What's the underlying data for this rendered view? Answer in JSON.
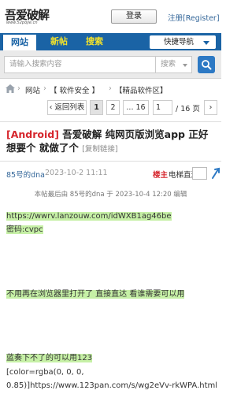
{
  "header": {
    "logo_text": "吾爱破解",
    "logo_sub": "www.52pojie.cn",
    "login_label": "登录",
    "register_label": "注册[Register]"
  },
  "nav": {
    "tabs": [
      {
        "label": "网站"
      },
      {
        "label": "新帖"
      },
      {
        "label": "搜索"
      }
    ],
    "quick_nav_label": "快捷导航"
  },
  "search": {
    "placeholder": "请输入搜索内容",
    "type_label": "搜索"
  },
  "breadcrumb": {
    "items": [
      "网站",
      "【 软件安全 】",
      "【精品软件区】"
    ],
    "separator": "›"
  },
  "pagination": {
    "back_label": "‹ 返回列表",
    "pages": [
      "1",
      "2",
      "... 16"
    ],
    "current_page": "1",
    "total_label": "/ 16 页",
    "next_label": "›"
  },
  "thread": {
    "tag": "[Android]",
    "title": " 吾爱破解 纯网页版浏览app 正好想要个 就做了个",
    "copy_link": "[复制链接]"
  },
  "post": {
    "author": "85号的dna",
    "date": "2023-10-2 11:11",
    "op_badge": "楼主",
    "jump_label": "电梯直达",
    "edit_note": "本帖最后由 85号的dna 于 2023-10-4 12:20 编辑",
    "lines": [
      {
        "text": "https://wwrv.lanzouw.com/idWXB1ag46be",
        "highlight": true
      },
      {
        "text": "密码:cvpc",
        "highlight": true
      },
      {
        "text": "不用再在浏览器里打开了 直接直达 看谁需要可以用",
        "highlight": true
      },
      {
        "text": "蓝奏下不了的可以用123",
        "highlight": true
      },
      {
        "text": "[color=rgba(0, 0, 0,",
        "highlight": false
      },
      {
        "text": "0.85)]https://www.123pan.com/s/wg2eVv-rkWPA.html",
        "highlight": false
      }
    ]
  },
  "colors": {
    "nav_bg": "#1a63a5",
    "nav_tab_text": "#f4e32a",
    "highlight_bg": "#c6f0a6",
    "tag_red": "#d6262d",
    "link_blue": "#336699"
  }
}
